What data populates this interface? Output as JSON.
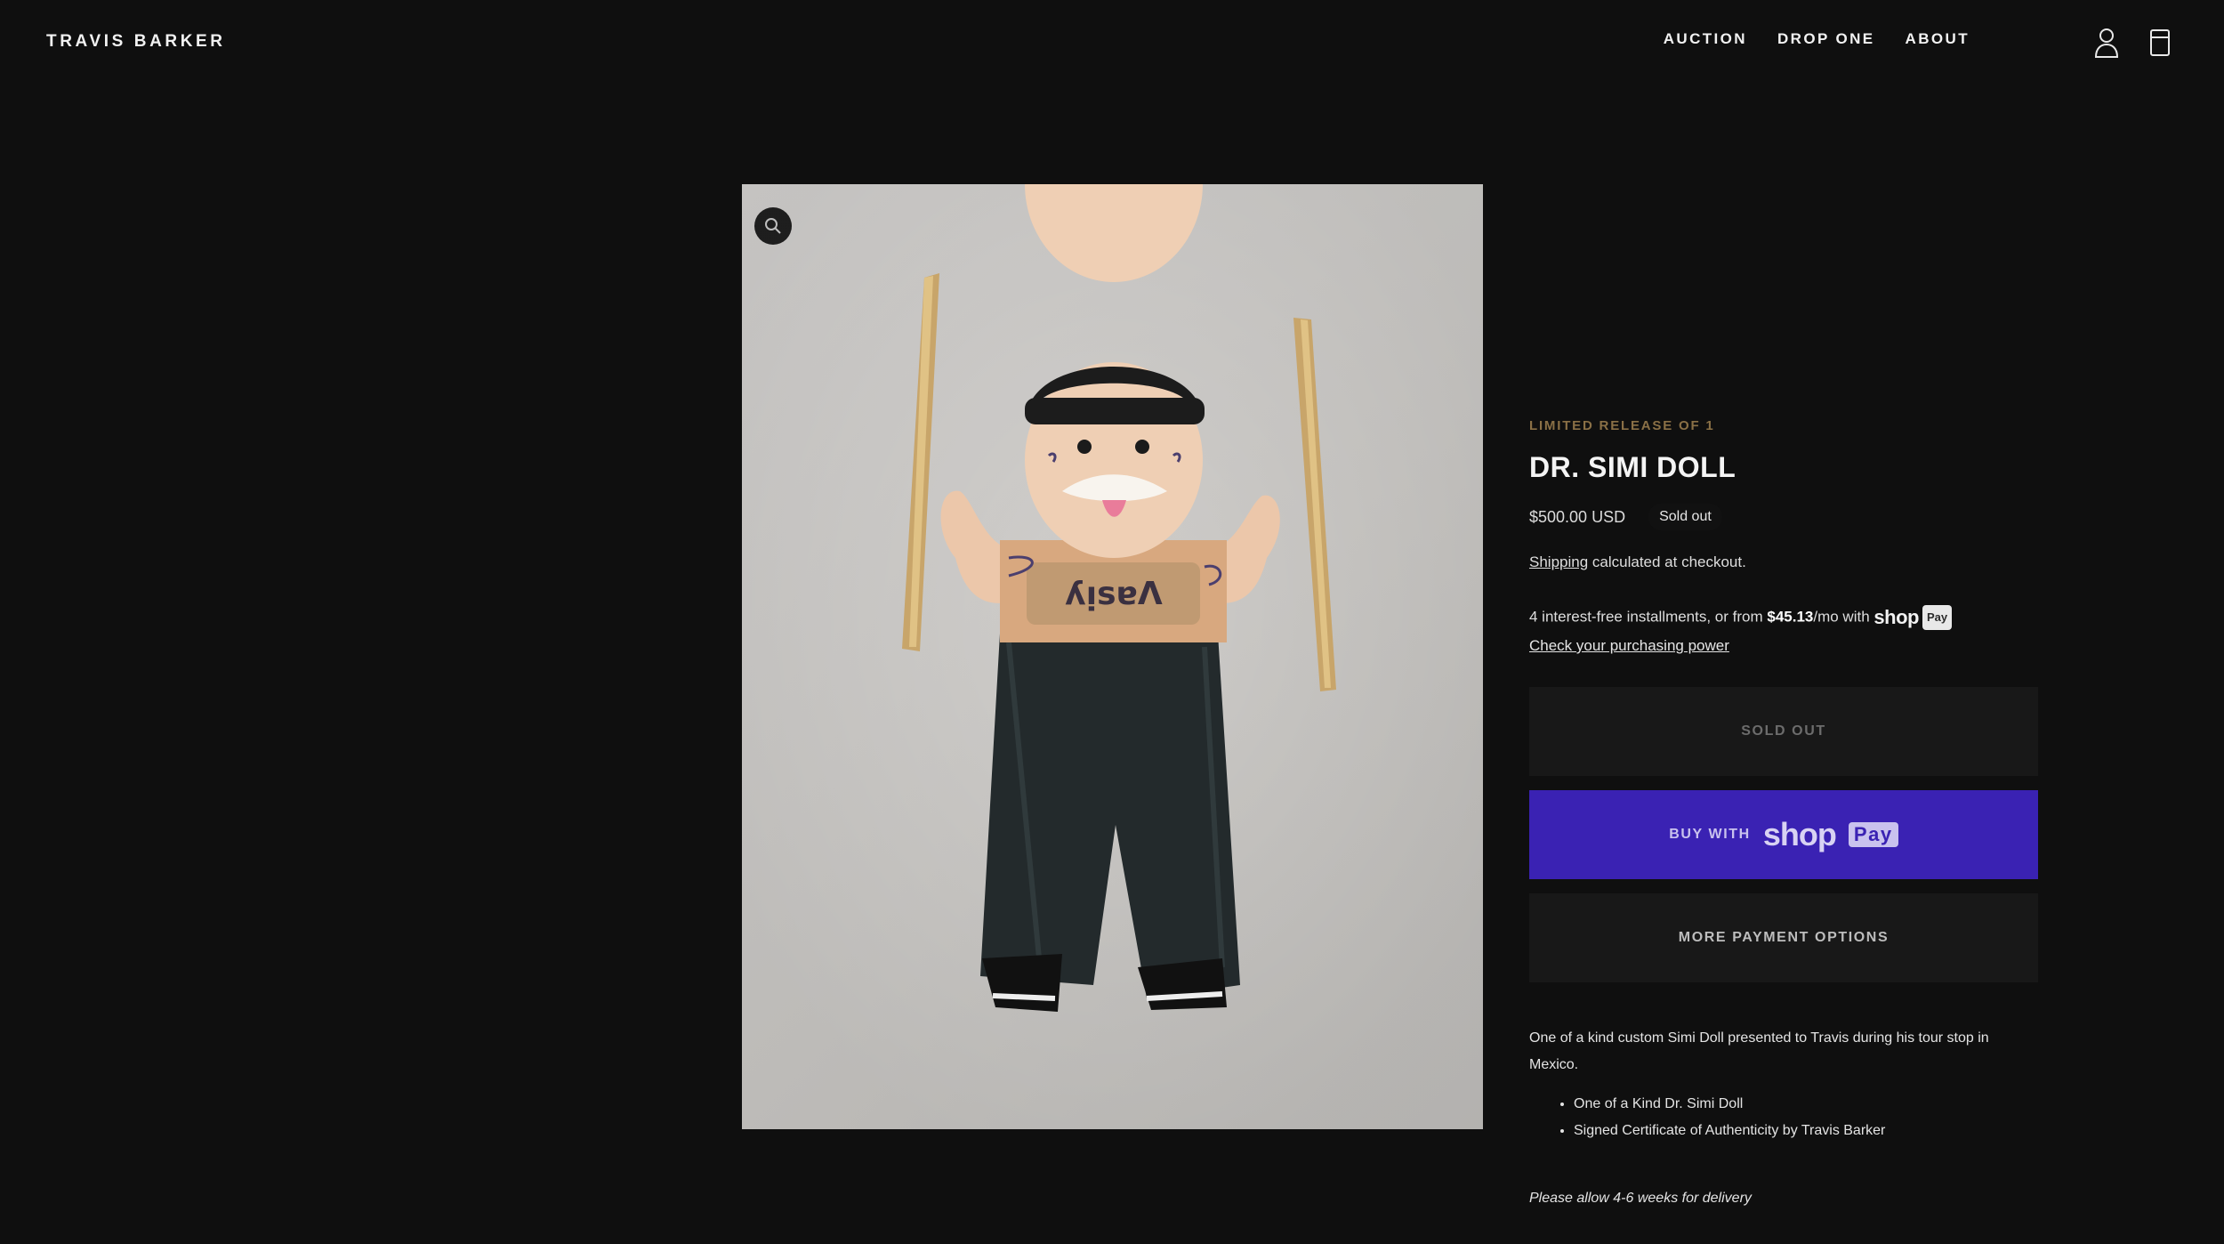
{
  "header": {
    "brand": "TRAVIS BARKER",
    "nav": [
      "AUCTION",
      "DROP ONE",
      "ABOUT"
    ],
    "icons": [
      "account-icon",
      "cart-icon"
    ]
  },
  "product": {
    "eyebrow": "LIMITED RELEASE OF 1",
    "title": "DR. SIMI DOLL",
    "price": "$500.00 USD",
    "status_badge": "Sold out",
    "shipping_link": "Shipping",
    "shipping_text": " calculated at checkout.",
    "installments_prefix": "4 interest-free installments, or from ",
    "installments_amount": "$45.13",
    "installments_suffix": "/mo with ",
    "shop_word": "shop",
    "pay_chip": "Pay",
    "check_link": "Check your purchasing power",
    "buttons": {
      "sold_out": "SOLD OUT",
      "buy_with": "BUY WITH",
      "more_options": "MORE PAYMENT OPTIONS"
    },
    "description": "One of a kind custom Simi Doll presented to Travis during his tour stop in Mexico.",
    "bullets": [
      "One of a Kind Dr. Simi Doll",
      "Signed Certificate of Authenticity by Travis Barker"
    ],
    "note": "Please allow 4-6 weeks for delivery"
  },
  "colors": {
    "background": "#0f0f0f",
    "accent_eyebrow": "#8a7046",
    "shoppay_button": "#3a22b3"
  }
}
